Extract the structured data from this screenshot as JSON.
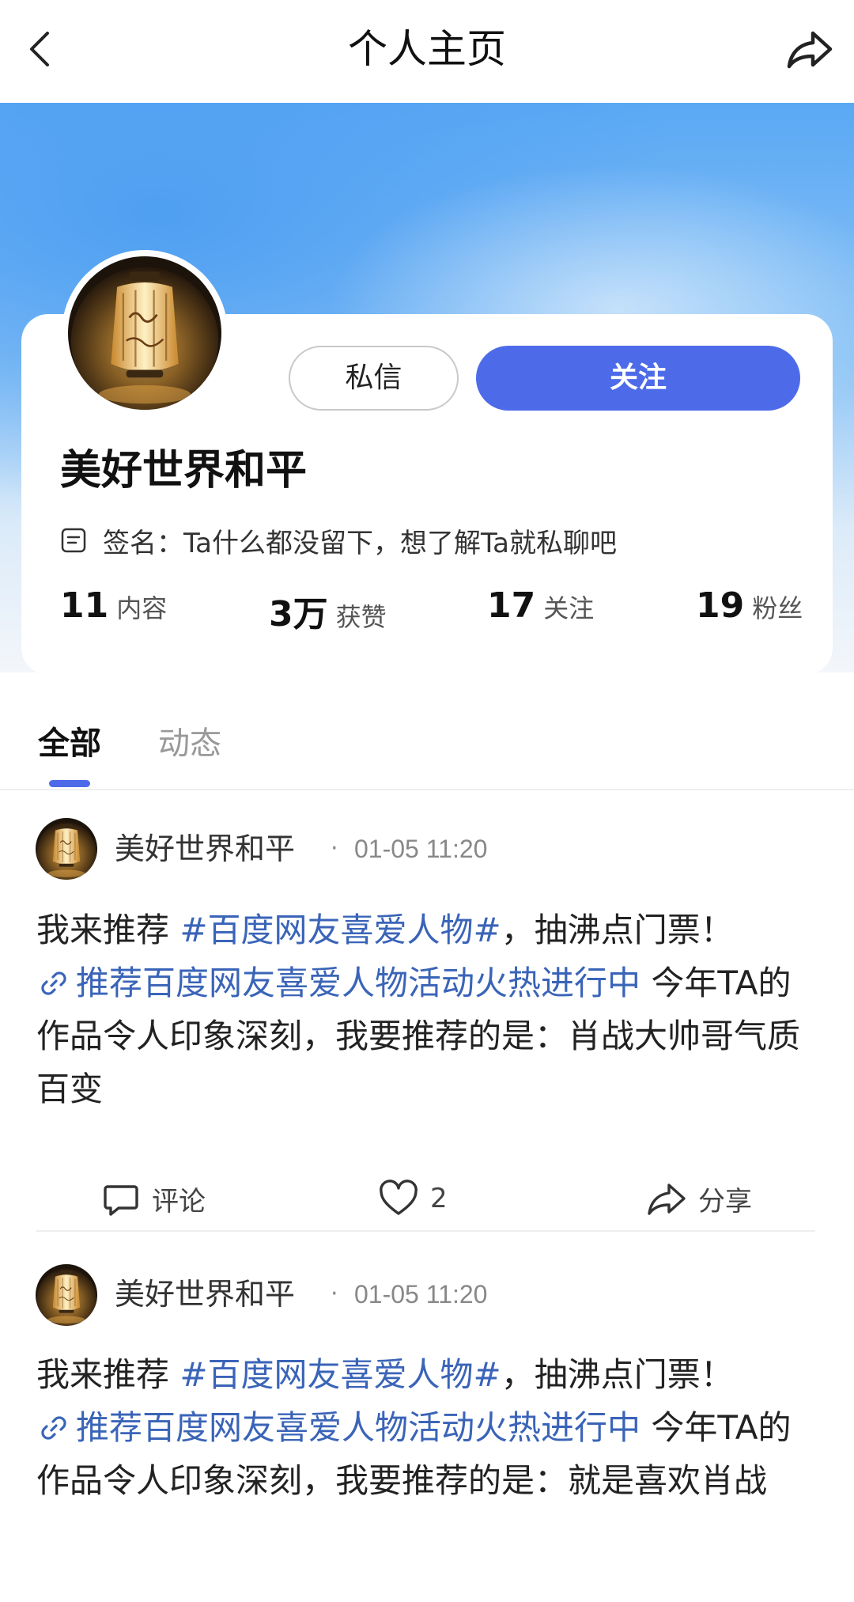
{
  "header": {
    "title": "个人主页",
    "back_icon": "chevron-left-icon",
    "share_icon": "share-icon"
  },
  "profile": {
    "nickname": "美好世界和平",
    "message_button": "私信",
    "follow_button": "关注",
    "signature": "签名：Ta什么都没留下，想了解Ta就私聊吧",
    "stats": [
      {
        "value": "11",
        "label": "内容"
      },
      {
        "value": "3万",
        "label": "获赞"
      },
      {
        "value": "17",
        "label": "关注"
      },
      {
        "value": "19",
        "label": "粉丝"
      }
    ]
  },
  "tabs": {
    "all": "全部",
    "dynamic": "动态",
    "active": "全部"
  },
  "posts": [
    {
      "author": "美好世界和平",
      "dot": "·",
      "time": "01-05 11:20",
      "text_prefix": "我来推荐 ",
      "hashtag": "#百度网友喜爱人物#",
      "text_after_tag": "，抽沸点门票！",
      "link": "推荐百度网友喜爱人物活动火热进行中",
      "text_suffix": " 今年TA的作品令人印象深刻，我要推荐的是：肖战大帅哥气质百变",
      "comment_label": "评论",
      "like_count": "2",
      "share_label": "分享"
    },
    {
      "author": "美好世界和平",
      "dot": "·",
      "time": "01-05 11:20",
      "text_prefix": "我来推荐 ",
      "hashtag": "#百度网友喜爱人物#",
      "text_after_tag": "，抽沸点门票！",
      "link": "推荐百度网友喜爱人物活动火热进行中",
      "text_suffix": " 今年TA的作品令人印象深刻，我要推荐的是：就是喜欢肖战"
    }
  ],
  "colors": {
    "accent": "#4d6be9",
    "link": "#3a64b8",
    "hero_blue": "#5aa8f4"
  }
}
